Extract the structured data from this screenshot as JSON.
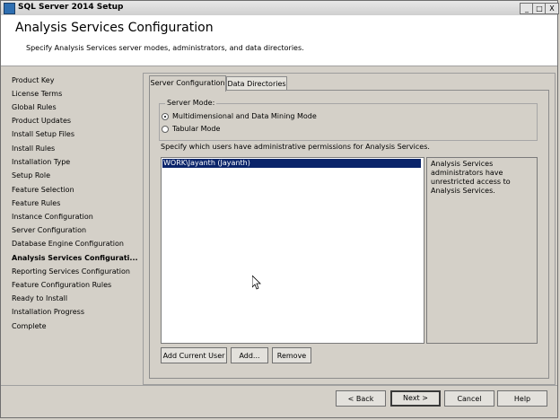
{
  "window": {
    "title": "SQL Server 2014 Setup",
    "controls": {
      "minimize": "_",
      "maximize": "□",
      "close": "X"
    }
  },
  "header": {
    "title": "Analysis Services Configuration",
    "description": "Specify Analysis Services server modes, administrators, and data directories."
  },
  "sidebar": {
    "items": [
      {
        "label": "Product Key"
      },
      {
        "label": "License Terms"
      },
      {
        "label": "Global Rules"
      },
      {
        "label": "Product Updates"
      },
      {
        "label": "Install Setup Files"
      },
      {
        "label": "Install Rules"
      },
      {
        "label": "Installation Type"
      },
      {
        "label": "Setup Role"
      },
      {
        "label": "Feature Selection"
      },
      {
        "label": "Feature Rules"
      },
      {
        "label": "Instance Configuration"
      },
      {
        "label": "Server Configuration"
      },
      {
        "label": "Database Engine Configuration"
      },
      {
        "label": "Analysis Services Configurati..."
      },
      {
        "label": "Reporting Services Configuration"
      },
      {
        "label": "Feature Configuration Rules"
      },
      {
        "label": "Ready to Install"
      },
      {
        "label": "Installation Progress"
      },
      {
        "label": "Complete"
      }
    ]
  },
  "tabs": [
    {
      "label": "Server Configuration"
    },
    {
      "label": "Data Directories"
    }
  ],
  "server_mode": {
    "label": "Server Mode:",
    "options": [
      {
        "label": "Multidimensional and Data Mining Mode",
        "selected": true
      },
      {
        "label": "Tabular Mode",
        "selected": false
      }
    ]
  },
  "admins": {
    "label": "Specify which users have administrative permissions for Analysis Services.",
    "users": [
      "WORK\\Jayanth (Jayanth)"
    ],
    "info": "Analysis Services administrators have unrestricted access to Analysis Services."
  },
  "admin_buttons": {
    "add_current": "Add Current User",
    "add": "Add...",
    "remove": "Remove"
  },
  "footer": {
    "back": "< Back",
    "next": "Next >",
    "cancel": "Cancel",
    "help": "Help"
  }
}
